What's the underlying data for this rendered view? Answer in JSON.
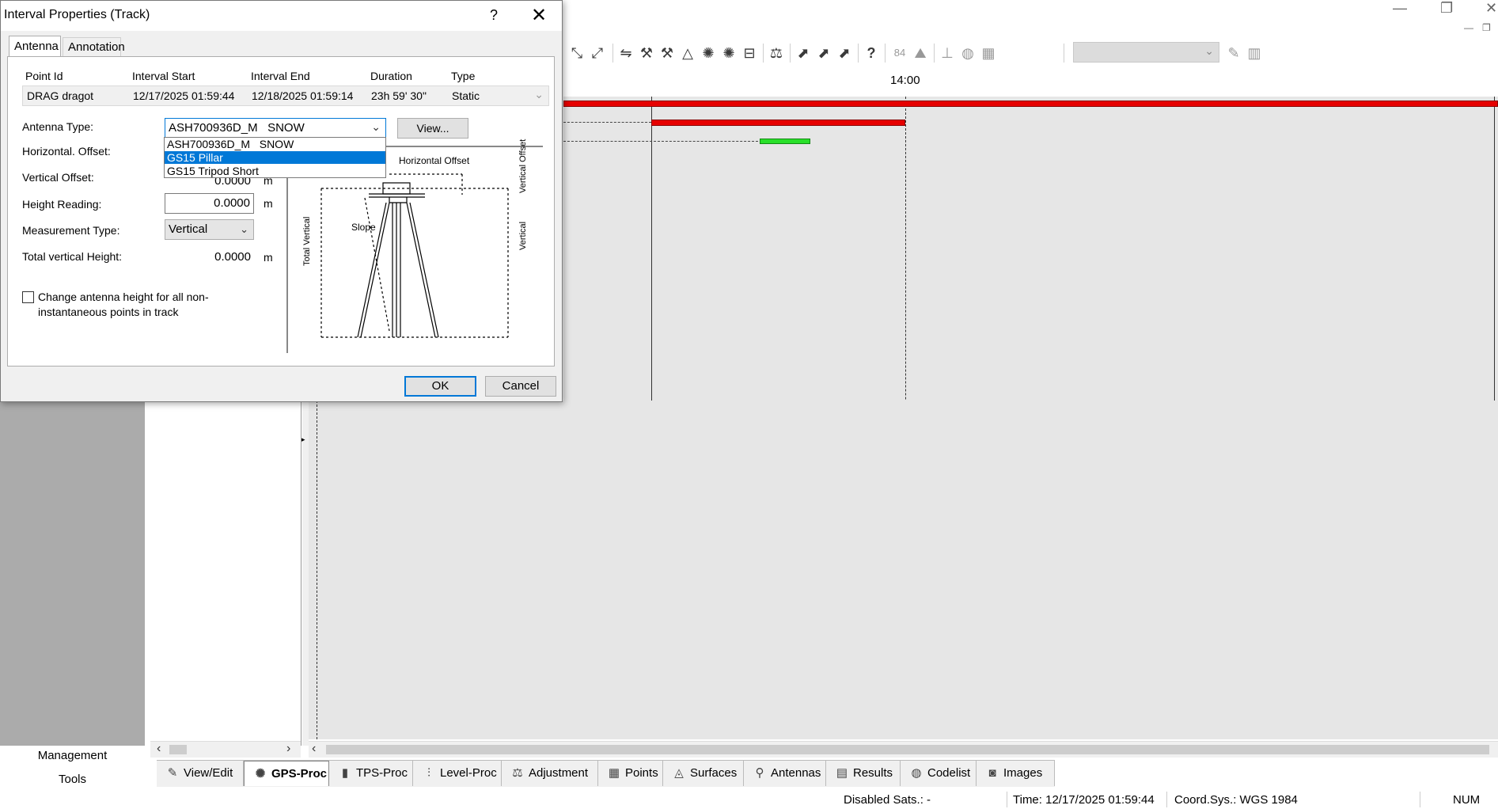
{
  "dialog": {
    "title": "Interval Properties (Track)",
    "help_glyph": "?",
    "close_glyph": "✕",
    "tabs": [
      "Antenna",
      "Annotation"
    ],
    "active_tab": "Antenna",
    "columns": {
      "point_id": "Point Id",
      "interval_start": "Interval Start",
      "interval_end": "Interval End",
      "duration": "Duration",
      "type": "Type"
    },
    "row": {
      "point_id": "DRAG dragot",
      "interval_start": "12/17/2025 01:59:44",
      "interval_end": "12/18/2025 01:59:14",
      "duration": "23h 59' 30\"",
      "type": "Static"
    },
    "antenna_type_label": "Antenna Type:",
    "antenna_type_value": "ASH700936D_M   SNOW",
    "antenna_options": [
      "ASH700936D_M   SNOW",
      "GS15 Pillar",
      "GS15 Tripod Short"
    ],
    "antenna_highlighted_index": 1,
    "view_button": "View...",
    "horizontal_offset_label": "Horizontal. Offset:",
    "vertical_offset_label": "Vertical Offset:",
    "vertical_offset_value": "0.0000",
    "height_reading_label": "Height Reading:",
    "height_reading_value": "0.0000",
    "measurement_type_label": "Measurement Type:",
    "measurement_type_value": "Vertical",
    "total_vertical_height_label": "Total vertical Height:",
    "total_vertical_height_value": "0.0000",
    "unit": "m",
    "change_height_checkbox": {
      "label": "Change antenna height for all non-instantaneous points in track",
      "checked": false
    },
    "diagram_labels": {
      "horizontal_offset": "Horizontal Offset",
      "vertical_offset": "Vertical Offset",
      "slope": "Slope",
      "total_vertical": "Total Vertical",
      "vertical": "Vertical"
    },
    "ok_button": "OK",
    "cancel_button": "Cancel"
  },
  "window_controls": {
    "minimize": "—",
    "restore": "❐",
    "close": "✕"
  },
  "timeline": {
    "time_label": "14:00",
    "bar_red_color": "#e60000",
    "bar_green_color": "#29e02a"
  },
  "left_panel": {
    "items": [
      "Management",
      "Tools"
    ]
  },
  "module_tabs": [
    {
      "label": "View/Edit",
      "icon": "view-edit-icon",
      "glyph": "✎"
    },
    {
      "label": "GPS-Proc",
      "icon": "gps-proc-icon",
      "glyph": "✺"
    },
    {
      "label": "TPS-Proc",
      "icon": "tps-proc-icon",
      "glyph": "▮"
    },
    {
      "label": "Level-Proc",
      "icon": "level-proc-icon",
      "glyph": "⫶"
    },
    {
      "label": "Adjustment",
      "icon": "adjustment-icon",
      "glyph": "⚖"
    },
    {
      "label": "Points",
      "icon": "points-icon",
      "glyph": "▦"
    },
    {
      "label": "Surfaces",
      "icon": "surfaces-icon",
      "glyph": "◬"
    },
    {
      "label": "Antennas",
      "icon": "antennas-icon",
      "glyph": "⚲"
    },
    {
      "label": "Results",
      "icon": "results-icon",
      "glyph": "▤"
    },
    {
      "label": "Codelist",
      "icon": "codelist-icon",
      "glyph": "◍"
    },
    {
      "label": "Images",
      "icon": "images-icon",
      "glyph": "◙"
    }
  ],
  "active_module": "GPS-Proc",
  "status_bar": {
    "disabled_sats": "Disabled Sats.: -",
    "time": "Time: 12/17/2025 01:59:44",
    "coord_sys": "Coord.Sys.: WGS 1984",
    "num": "NUM"
  }
}
